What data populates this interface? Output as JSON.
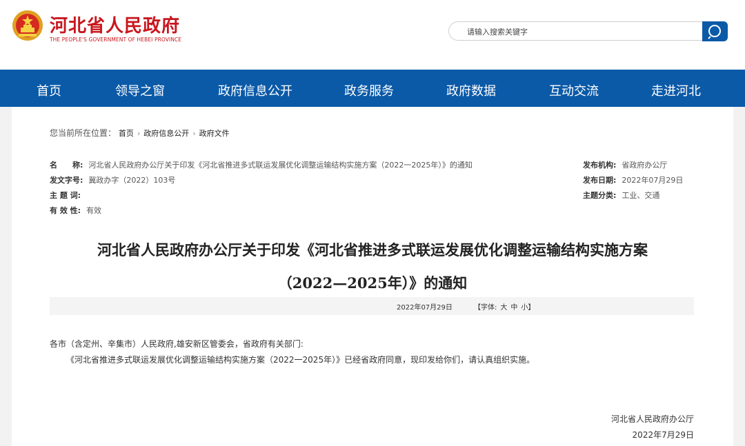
{
  "header": {
    "title": "河北省人民政府",
    "subtitle": "THE PEOPLE'S GOVERNMENT OF HEBEI PROVINCE",
    "search_placeholder": "请输入搜索关键字",
    "brand_color": "#c8161d",
    "nav_color": "#0b5aa8"
  },
  "nav": [
    "首页",
    "领导之窗",
    "政府信息公开",
    "政务服务",
    "政府数据",
    "互动交流",
    "走进河北"
  ],
  "breadcrumb": {
    "prefix": "您当前所在位置：",
    "items": [
      "首页",
      "政府信息公开",
      "政府文件"
    ]
  },
  "meta": {
    "name_label": "名　　称:",
    "name_value": "河北省人民政府办公厅关于印发《河北省推进多式联运发展优化调整运输结构实施方案（2022一2025年）》的通知",
    "docno_label": "发文字号:",
    "docno_value": "冀政办字（2022）103号",
    "keywords_label": "主 题 词:",
    "keywords_value": "",
    "validity_label": "有 效 性:",
    "validity_value": "有效",
    "issuer_label": "发布机构:",
    "issuer_value": "省政府办公厅",
    "date_label": "发布日期:",
    "date_value": "2022年07月29日",
    "category_label": "主题分类:",
    "category_value": "工业、交通"
  },
  "document": {
    "title_line1": "河北省人民政府办公厅关于印发《河北省推进多式联运发展优化调整运输结构实施方案",
    "title_line2": "（2022—2025年）》的通知",
    "date": "2022年07月29日",
    "font_label": "【字体:",
    "font_large": "大",
    "font_medium": "中",
    "font_small": "小】",
    "salutation": "各市（含定州、辛集市）人民政府,雄安新区管委会，省政府有关部门:",
    "paragraph1": "《河北省推进多式联运发展优化调整运输结构实施方案（2022一2025年）》已经省政府同意，现印发给你们，请认真组织实施。",
    "signature": "河北省人民政府办公厅",
    "signature_date": "2022年7月29日"
  }
}
